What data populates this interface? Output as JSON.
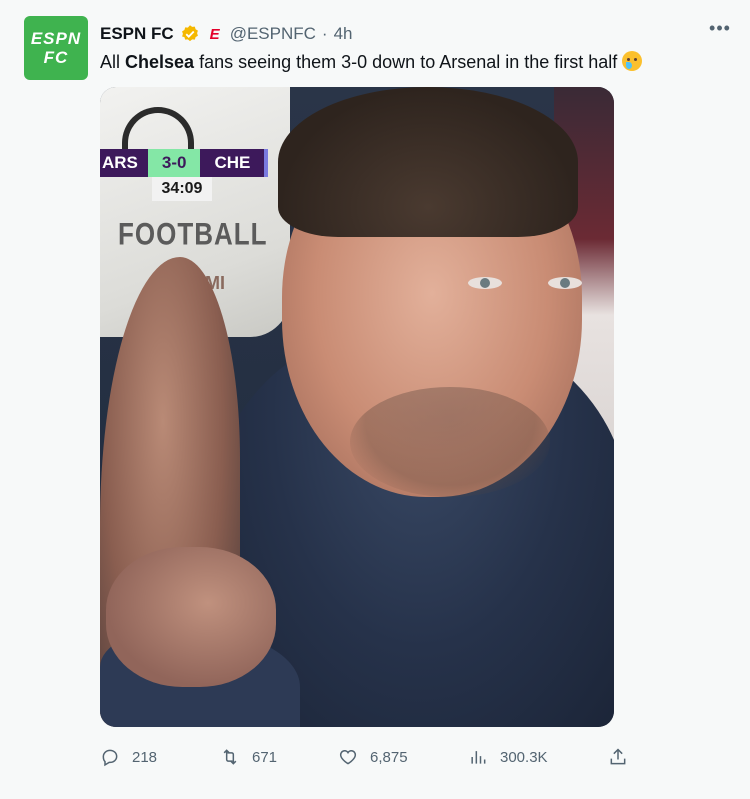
{
  "author": {
    "name": "ESPN FC",
    "handle": "@ESPNFC",
    "separator": "·",
    "time": "4h",
    "avatar_text_line1": "ESPN",
    "avatar_text_line2": "FC",
    "brand_mark": "E"
  },
  "tweet": {
    "text_pre": "All ",
    "text_bold": "Chelsea",
    "text_post": " fans seeing them 3-0 down to Arsenal in the first half ",
    "emoji": "face-holding-back-tears"
  },
  "media": {
    "scoreboard": {
      "home": "ARS",
      "score": "3-0",
      "away": "CHE",
      "clock": "34:09"
    },
    "seat_text_1": "FOOTBALL",
    "seat_text_2": "KONAMI"
  },
  "actions": {
    "replies": "218",
    "reposts": "671",
    "likes": "6,875",
    "views": "300.3K"
  },
  "colors": {
    "avatar_bg": "#3fb34f",
    "verified": "#f5b800",
    "brand_red": "#e4002b",
    "muted": "#536471",
    "pl_purple": "#3d195b"
  }
}
